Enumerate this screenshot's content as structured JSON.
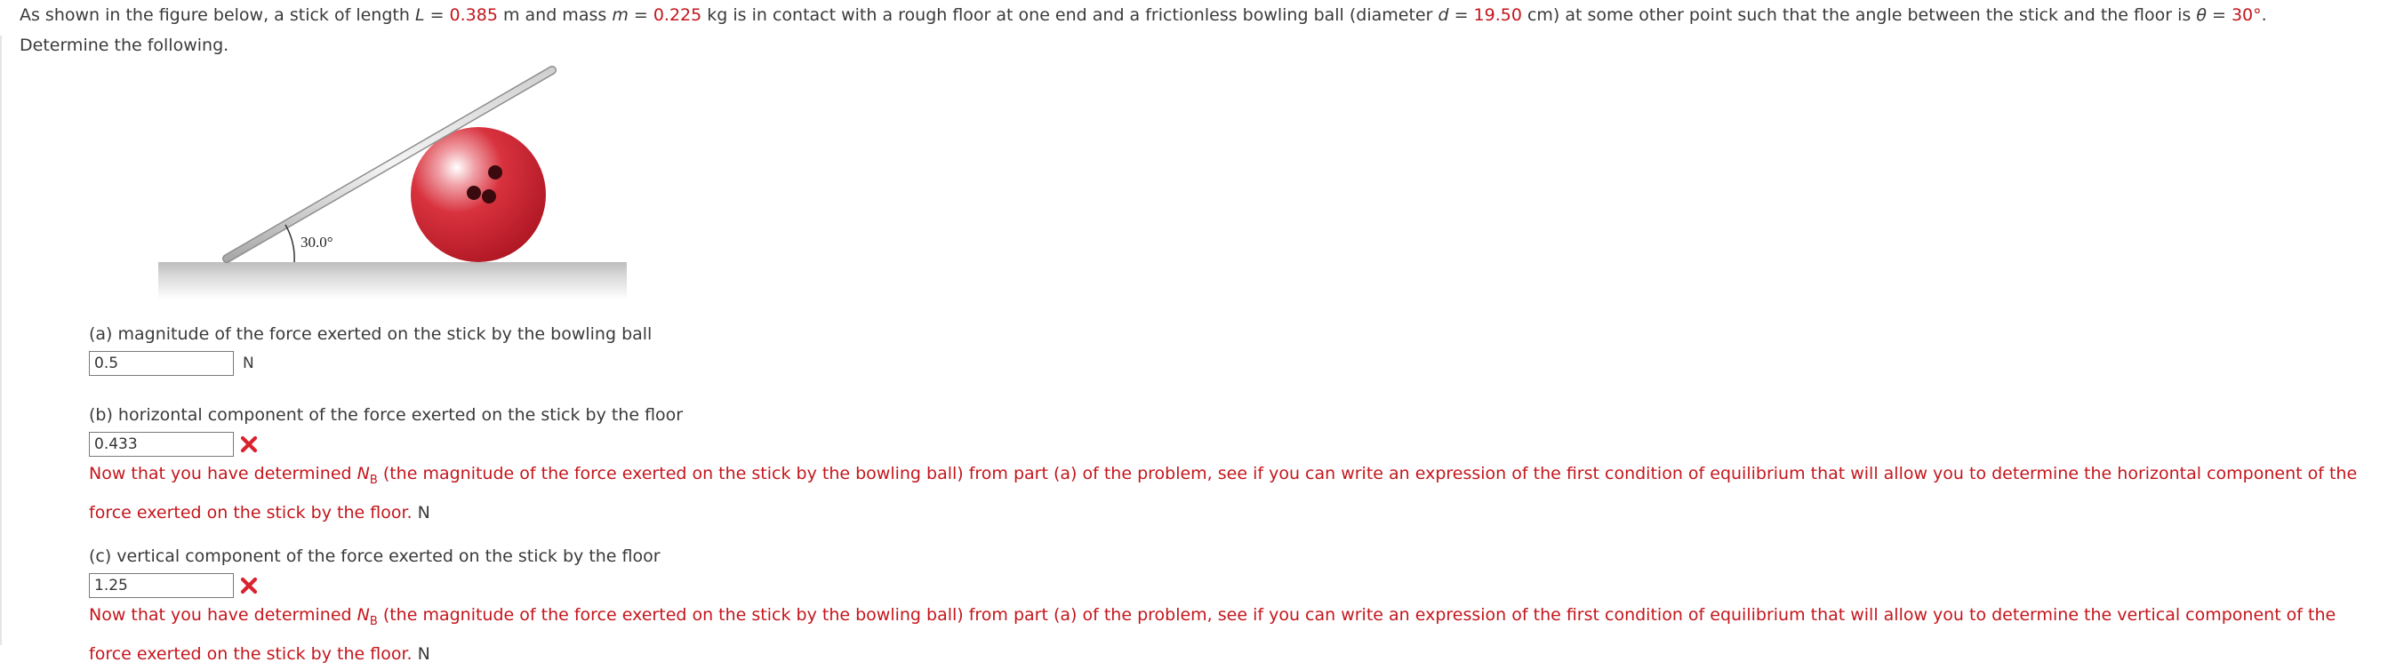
{
  "prompt": {
    "t1": "As shown in the figure below, a stick of length ",
    "L_sym": "L",
    "t2": " = ",
    "L_val": "0.385",
    "t3": " m and mass ",
    "m_sym": "m",
    "t4": " = ",
    "m_val": "0.225",
    "t5": " kg is in contact with a rough floor at one end and a frictionless bowling ball (diameter ",
    "d_sym": "d",
    "t6": " = ",
    "d_val": "19.50",
    "t7": " cm) at some other point such that the angle between the stick and the floor is ",
    "theta_sym": "θ",
    "t8": " = ",
    "theta_val": "30°",
    "t9": ".",
    "line2": "Determine the following."
  },
  "figure": {
    "angle_label": "30.0°",
    "colors": {
      "ball": "#c81e2a",
      "stick": "#b8b8b8",
      "floor": "#cfcfcf"
    }
  },
  "parts": [
    {
      "question": "(a) magnitude of the force exerted on the stick by the bowling ball",
      "value": "0.5",
      "unit": "N",
      "status": "none"
    },
    {
      "question": "(b) horizontal component of the force exerted on the stick by the floor",
      "value": "0.433",
      "status": "incorrect",
      "feedback_a": "Now that you have determined ",
      "feedback_sym": "N",
      "feedback_sub": "B",
      "feedback_b": " (the magnitude of the force exerted on the stick by the bowling ball) from part (a) of the problem, see if you can write an expression of the first condition of equilibrium that will allow you to determine the horizontal component of the force exerted on the stick by the floor.",
      "unit": "N"
    },
    {
      "question": "(c) vertical component of the force exerted on the stick by the floor",
      "value": "1.25",
      "status": "incorrect",
      "feedback_a": "Now that you have determined ",
      "feedback_sym": "N",
      "feedback_sub": "B",
      "feedback_b": " (the magnitude of the force exerted on the stick by the bowling ball) from part (a) of the problem, see if you can write an expression of the first condition of equilibrium that will allow you to determine the vertical component of the force exerted on the stick by the floor.",
      "unit": "N"
    }
  ],
  "colors": {
    "text": "#3a3a3a",
    "red": "#c4161c"
  }
}
